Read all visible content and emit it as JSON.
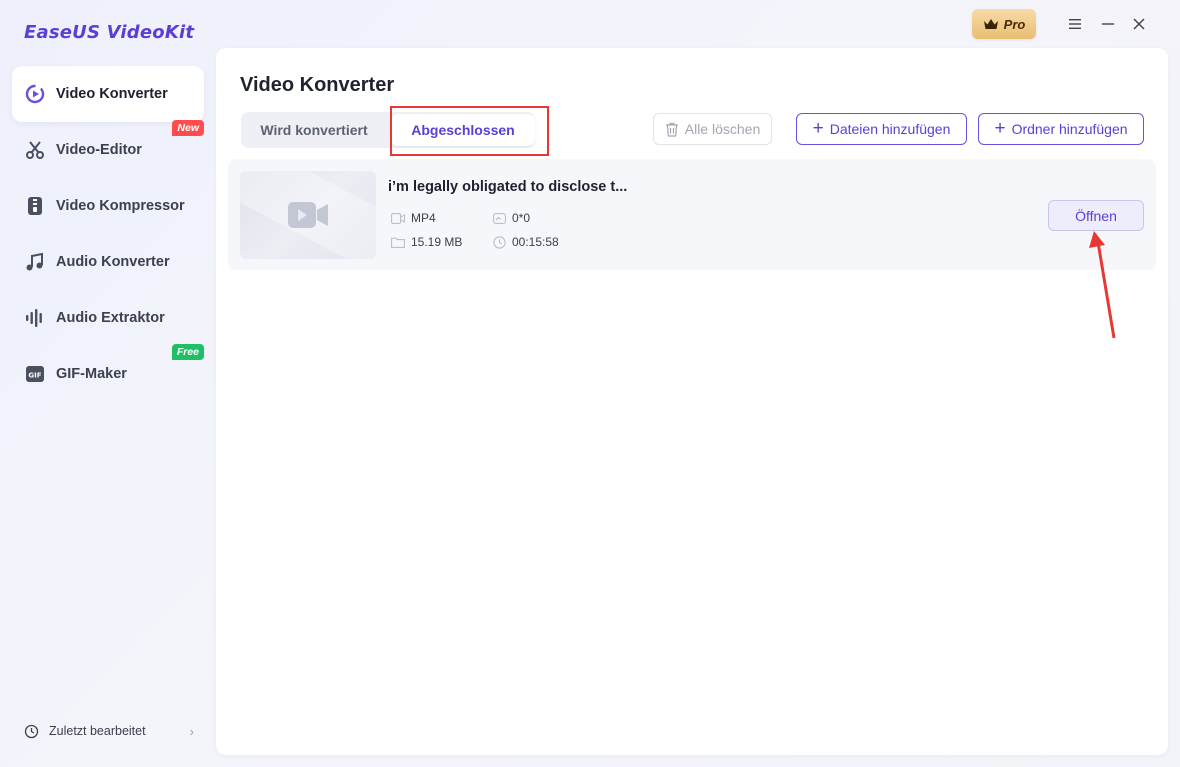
{
  "app": {
    "name": "EaseUS VideoKit",
    "pro_label": "Pro"
  },
  "sidebar": {
    "items": [
      {
        "label": "Video Konverter",
        "icon": "video-convert-icon",
        "active": true
      },
      {
        "label": "Video-Editor",
        "icon": "scissors-icon",
        "tag": "New"
      },
      {
        "label": "Video Kompressor",
        "icon": "compress-icon"
      },
      {
        "label": "Audio Konverter",
        "icon": "music-note-icon"
      },
      {
        "label": "Audio Extraktor",
        "icon": "audio-waveform-icon"
      },
      {
        "label": "GIF-Maker",
        "icon": "gif-icon",
        "tag": "Free"
      }
    ],
    "recent_label": "Zuletzt bearbeitet"
  },
  "main": {
    "title": "Video Konverter",
    "tabs": [
      {
        "label": "Wird konvertiert",
        "active": false
      },
      {
        "label": "Abgeschlossen",
        "active": true
      }
    ],
    "clear_all_label": "Alle löschen",
    "add_files_label": "Dateien hinzufügen",
    "add_folder_label": "Ordner hinzufügen"
  },
  "files": [
    {
      "name": "i’m legally obligated to disclose t...",
      "format": "MP4",
      "resolution": "0*0",
      "size": "15.19 MB",
      "duration": "00:15:58",
      "open_label": "Öffnen"
    }
  ],
  "colors": {
    "accent": "#5b3fd4",
    "annotation": "#e53935",
    "new_tag": "#ff4d4f",
    "free_tag": "#1fbf66"
  }
}
